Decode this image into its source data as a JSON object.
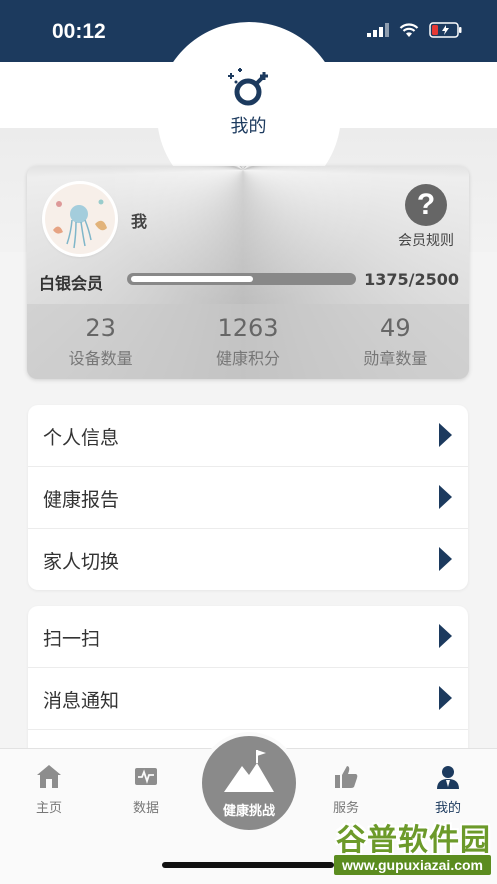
{
  "status_bar": {
    "time": "00:12",
    "signal_icon": "signal-icon",
    "wifi_icon": "wifi-icon",
    "battery_icon": "battery-low-icon"
  },
  "header": {
    "title": "我的",
    "logo_icon": "gender-symbol-logo-icon"
  },
  "profile": {
    "username": "我",
    "rules_label": "会员规则",
    "level_name": "白银会员",
    "points_progress": "1375/2500",
    "progress_fraction": 0.55
  },
  "stats": [
    {
      "value": "23",
      "label": "设备数量"
    },
    {
      "value": "1263",
      "label": "健康积分"
    },
    {
      "value": "49",
      "label": "勋章数量"
    }
  ],
  "menu_group_1": [
    {
      "label": "个人信息"
    },
    {
      "label": "健康报告"
    },
    {
      "label": "家人切换"
    }
  ],
  "menu_group_2": [
    {
      "label": "扫一扫"
    },
    {
      "label": "消息通知"
    },
    {
      "label": ""
    }
  ],
  "tabbar": {
    "tabs": [
      {
        "label": "主页",
        "icon": "home-icon"
      },
      {
        "label": "数据",
        "icon": "data-chart-icon"
      },
      {
        "label": "健康挑战",
        "icon": "mountain-flag-icon"
      },
      {
        "label": "服务",
        "icon": "thumbs-up-icon"
      },
      {
        "label": "我的",
        "icon": "user-icon"
      }
    ]
  },
  "watermark": {
    "title": "谷普软件园",
    "url": "www.gupuxiazai.com"
  },
  "colors": {
    "primary": "#1c3a5e",
    "stat_text": "#666666",
    "watermark_green": "#5b8c1f"
  }
}
